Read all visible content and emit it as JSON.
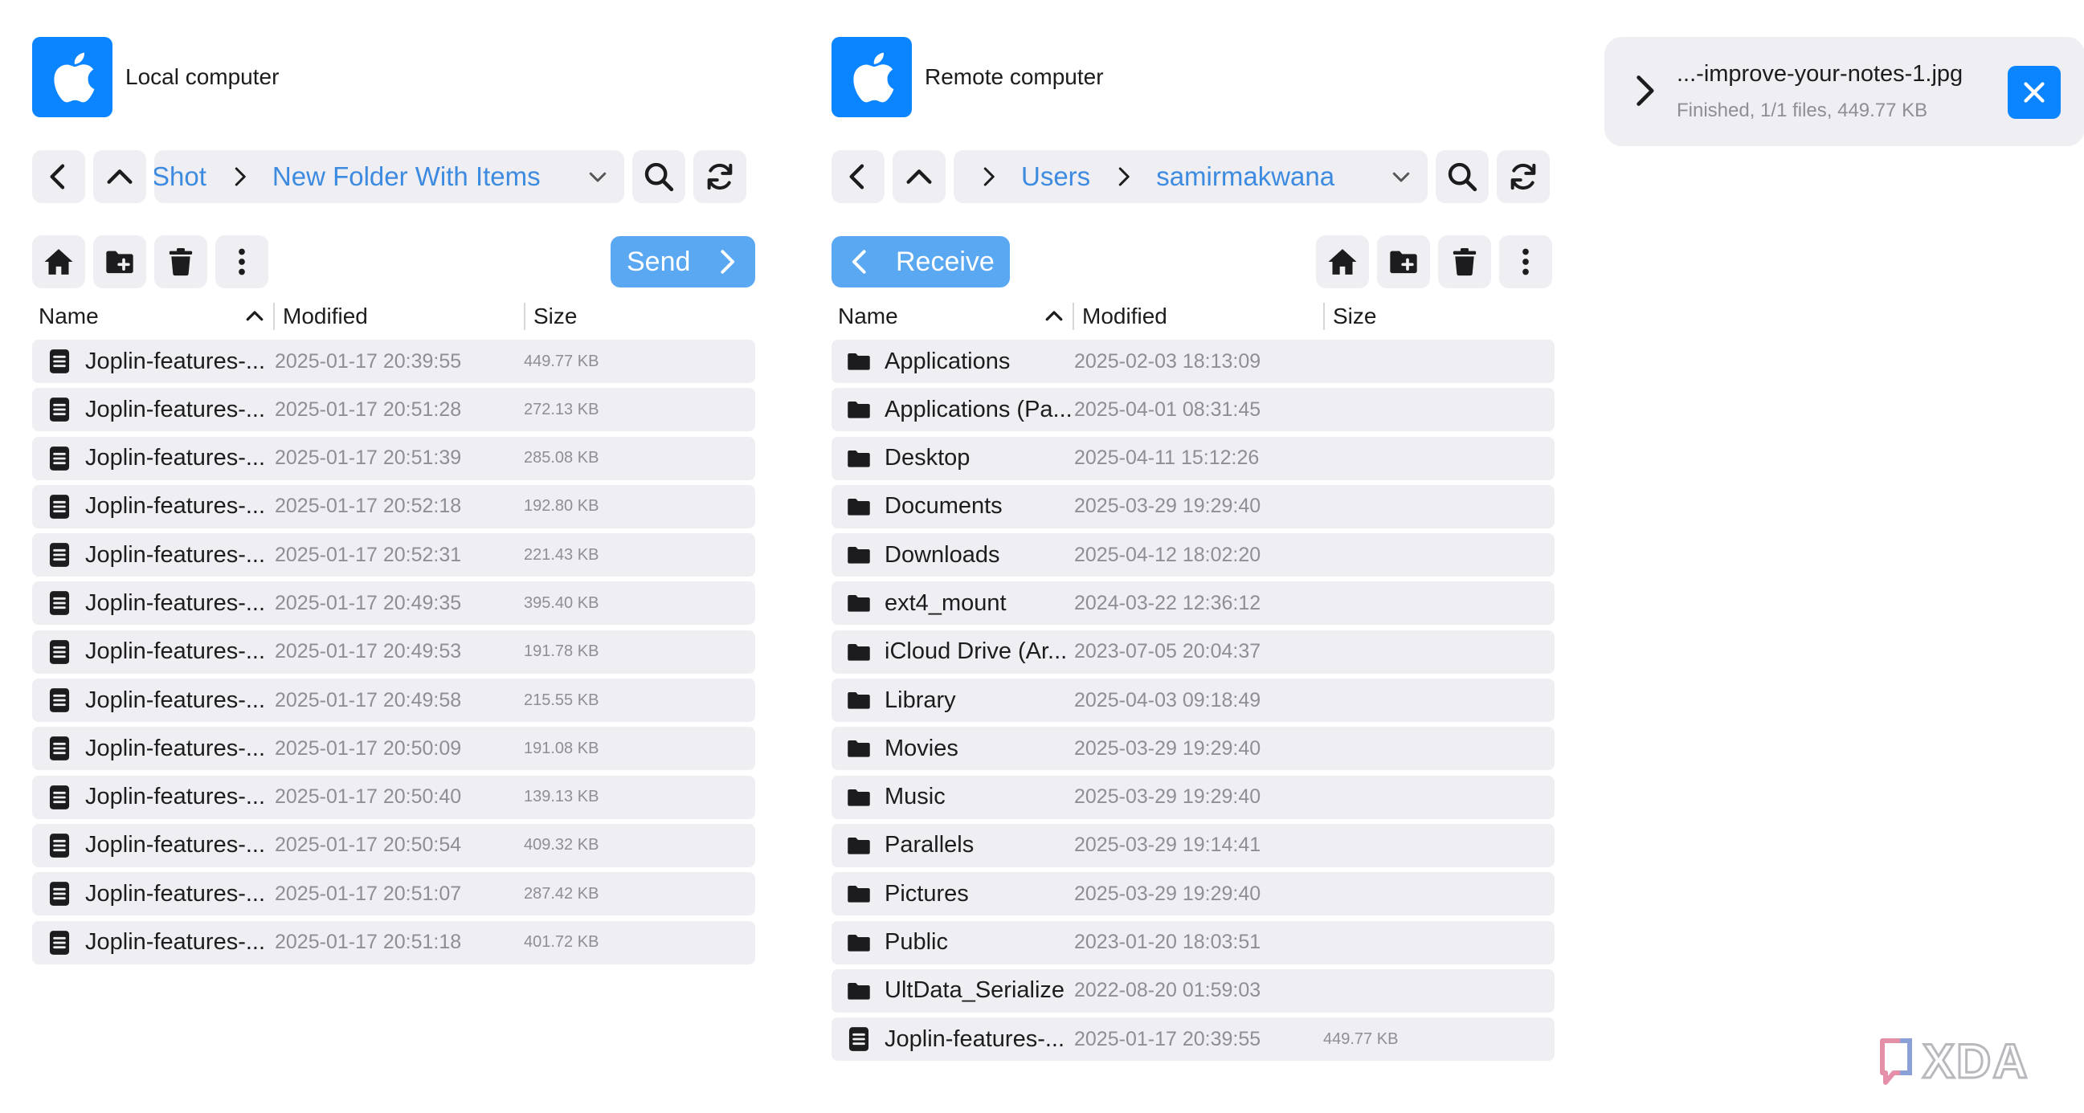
{
  "local": {
    "title": "Local computer",
    "os_icon": "apple-icon",
    "breadcrumbs": [
      "Shot",
      "New Folder With Items"
    ],
    "send_label": "Send",
    "columns": {
      "name": "Name",
      "modified": "Modified",
      "size": "Size"
    },
    "sort": {
      "column": "Name",
      "direction": "ascending"
    },
    "files": [
      {
        "name": "Joplin-features-...",
        "modified": "2025-01-17 20:39:55",
        "size": "449.77 KB",
        "type": "file"
      },
      {
        "name": "Joplin-features-...",
        "modified": "2025-01-17 20:51:28",
        "size": "272.13 KB",
        "type": "file"
      },
      {
        "name": "Joplin-features-...",
        "modified": "2025-01-17 20:51:39",
        "size": "285.08 KB",
        "type": "file"
      },
      {
        "name": "Joplin-features-...",
        "modified": "2025-01-17 20:52:18",
        "size": "192.80 KB",
        "type": "file"
      },
      {
        "name": "Joplin-features-...",
        "modified": "2025-01-17 20:52:31",
        "size": "221.43 KB",
        "type": "file"
      },
      {
        "name": "Joplin-features-...",
        "modified": "2025-01-17 20:49:35",
        "size": "395.40 KB",
        "type": "file"
      },
      {
        "name": "Joplin-features-...",
        "modified": "2025-01-17 20:49:53",
        "size": "191.78 KB",
        "type": "file"
      },
      {
        "name": "Joplin-features-...",
        "modified": "2025-01-17 20:49:58",
        "size": "215.55 KB",
        "type": "file"
      },
      {
        "name": "Joplin-features-...",
        "modified": "2025-01-17 20:50:09",
        "size": "191.08 KB",
        "type": "file"
      },
      {
        "name": "Joplin-features-...",
        "modified": "2025-01-17 20:50:40",
        "size": "139.13 KB",
        "type": "file"
      },
      {
        "name": "Joplin-features-...",
        "modified": "2025-01-17 20:50:54",
        "size": "409.32 KB",
        "type": "file"
      },
      {
        "name": "Joplin-features-...",
        "modified": "2025-01-17 20:51:07",
        "size": "287.42 KB",
        "type": "file"
      },
      {
        "name": "Joplin-features-...",
        "modified": "2025-01-17 20:51:18",
        "size": "401.72 KB",
        "type": "file"
      }
    ]
  },
  "remote": {
    "title": "Remote computer",
    "os_icon": "apple-icon",
    "breadcrumbs": [
      "Users",
      "samirmakwana"
    ],
    "receive_label": "Receive",
    "columns": {
      "name": "Name",
      "modified": "Modified",
      "size": "Size"
    },
    "sort": {
      "column": "Name",
      "direction": "ascending"
    },
    "files": [
      {
        "name": "Applications",
        "modified": "2025-02-03 18:13:09",
        "size": "",
        "type": "folder"
      },
      {
        "name": "Applications (Pa...",
        "modified": "2025-04-01 08:31:45",
        "size": "",
        "type": "folder"
      },
      {
        "name": "Desktop",
        "modified": "2025-04-11 15:12:26",
        "size": "",
        "type": "folder"
      },
      {
        "name": "Documents",
        "modified": "2025-03-29 19:29:40",
        "size": "",
        "type": "folder"
      },
      {
        "name": "Downloads",
        "modified": "2025-04-12 18:02:20",
        "size": "",
        "type": "folder"
      },
      {
        "name": "ext4_mount",
        "modified": "2024-03-22 12:36:12",
        "size": "",
        "type": "folder"
      },
      {
        "name": "iCloud Drive (Ar...",
        "modified": "2023-07-05 20:04:37",
        "size": "",
        "type": "folder"
      },
      {
        "name": "Library",
        "modified": "2025-04-03 09:18:49",
        "size": "",
        "type": "folder"
      },
      {
        "name": "Movies",
        "modified": "2025-03-29 19:29:40",
        "size": "",
        "type": "folder"
      },
      {
        "name": "Music",
        "modified": "2025-03-29 19:29:40",
        "size": "",
        "type": "folder"
      },
      {
        "name": "Parallels",
        "modified": "2025-03-29 19:14:41",
        "size": "",
        "type": "folder"
      },
      {
        "name": "Pictures",
        "modified": "2025-03-29 19:29:40",
        "size": "",
        "type": "folder"
      },
      {
        "name": "Public",
        "modified": "2023-01-20 18:03:51",
        "size": "",
        "type": "folder"
      },
      {
        "name": "UltData_Serialize",
        "modified": "2022-08-20 01:59:03",
        "size": "",
        "type": "folder"
      },
      {
        "name": "Joplin-features-...",
        "modified": "2025-01-17 20:39:55",
        "size": "449.77 KB",
        "type": "file"
      }
    ]
  },
  "transfer": {
    "filename": "...-improve-your-notes-1.jpg",
    "status": "Finished, 1/1 files, 449.77 KB"
  },
  "watermark": {
    "text": "XDA"
  },
  "colors": {
    "accent": "#0a84ff",
    "link": "#3d8be0",
    "action_button": "#5aa7f2",
    "surface": "#eeeef3",
    "muted_text": "#8e8e93"
  }
}
